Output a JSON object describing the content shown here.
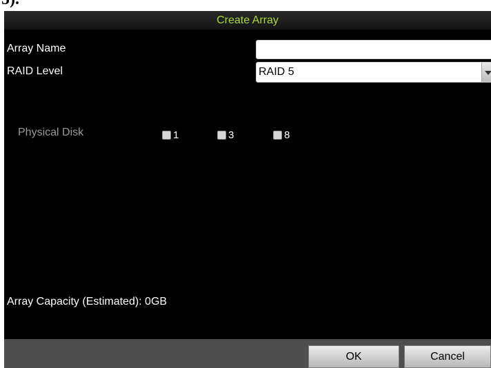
{
  "page_artifact": "5).",
  "dialog": {
    "title": "Create Array",
    "array_name_label": "Array Name",
    "array_name_value": "",
    "raid_level_label": "RAID Level",
    "raid_level_value": "RAID 5",
    "physical_disk_label": "Physical Disk",
    "disks": [
      {
        "number": "1",
        "checked": false
      },
      {
        "number": "3",
        "checked": false
      },
      {
        "number": "8",
        "checked": false
      }
    ],
    "capacity_text": "Array Capacity (Estimated): 0GB",
    "ok_label": "OK",
    "cancel_label": "Cancel"
  },
  "colors": {
    "dialog_bg": "#000000",
    "title_text": "#a8d83a",
    "footer_bg": "#4e4e4e",
    "disabled_label": "#9a9a9a"
  },
  "icons": {
    "dropdown": "chevron-down-icon",
    "checkbox": "checkbox-unchecked"
  }
}
